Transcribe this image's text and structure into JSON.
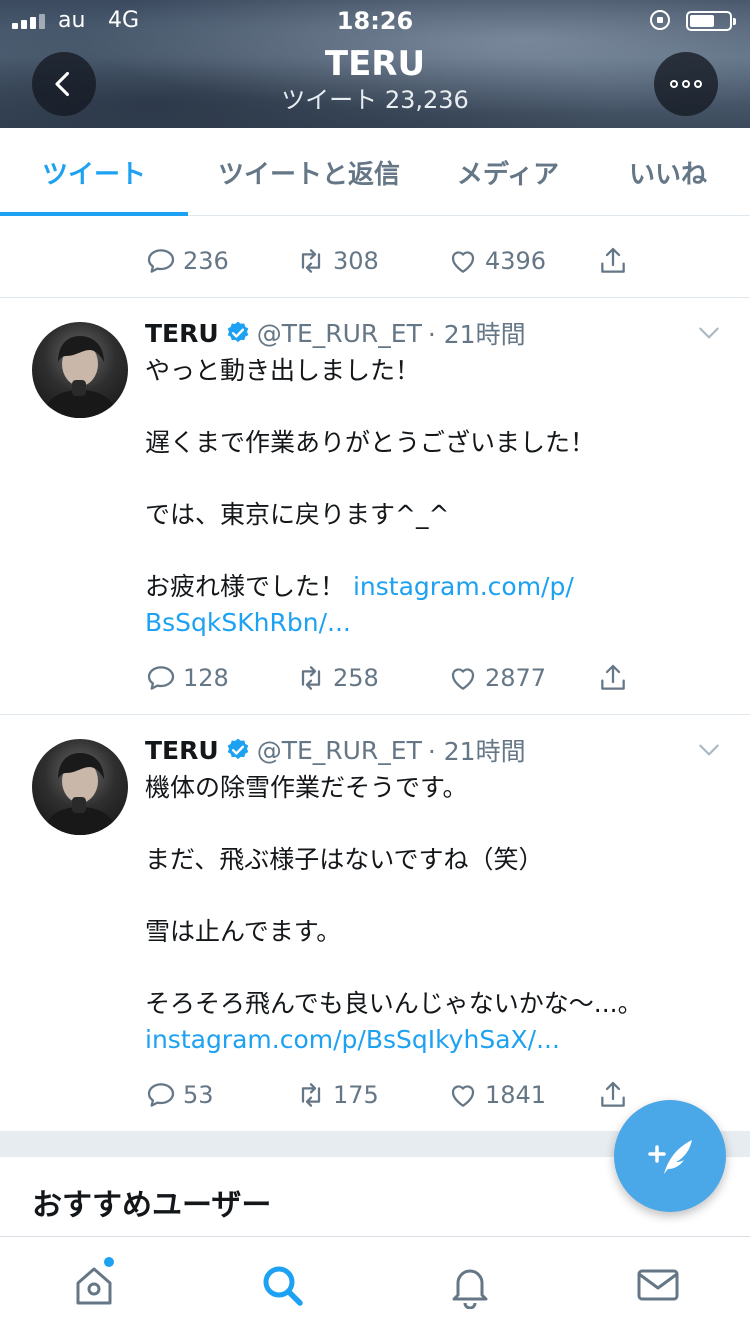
{
  "status_bar": {
    "carrier": "au",
    "network": "4G",
    "time": "18:26"
  },
  "header": {
    "title": "TERU",
    "subtitle": "ツイート 23,236"
  },
  "tabs": [
    {
      "label": "ツイート",
      "active": true
    },
    {
      "label": "ツイートと返信",
      "active": false
    },
    {
      "label": "メディア",
      "active": false
    },
    {
      "label": "いいね",
      "active": false
    }
  ],
  "prev_tweet_actions": {
    "replies": "236",
    "retweets": "308",
    "likes": "4396"
  },
  "tweets": [
    {
      "name": "TERU",
      "handle": "@TE_RUR_ET",
      "time": "· 21時間",
      "text": "やっと動き出しました！\n\n遅くまで作業ありがとうございました！\n\nでは、東京に戻ります^_^\n\nお疲れ様でした！ ",
      "link": "instagram.com/p/\nBsSqkSKhRbn/...",
      "replies": "128",
      "retweets": "258",
      "likes": "2877"
    },
    {
      "name": "TERU",
      "handle": "@TE_RUR_ET",
      "time": "· 21時間",
      "text": "機体の除雪作業だそうです。\n\nまだ、飛ぶ様子はないですね（笑）\n\n雪は止んでます。\n\nそろそろ飛んでも良いんじゃないかな〜...。\n",
      "link": "instagram.com/p/BsSqIkyhSaX/...",
      "replies": "53",
      "retweets": "175",
      "likes": "1841"
    }
  ],
  "recommended": {
    "title": "おすすめユーザー"
  },
  "icons": {
    "reply": "reply-icon",
    "retweet": "retweet-icon",
    "like": "heart-icon",
    "share": "share-icon",
    "compose": "compose-tweet-icon",
    "home": "home-icon",
    "search": "search-icon",
    "notifications": "bell-icon",
    "messages": "envelope-icon"
  },
  "colors": {
    "accent": "#1da1f2",
    "muted": "#657786",
    "text": "#14171a"
  }
}
